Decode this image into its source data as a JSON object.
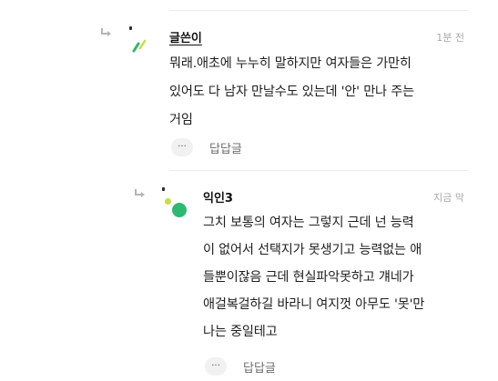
{
  "colors": {
    "text": "#222222",
    "muted": "#a8a8a8",
    "divider": "#ececec",
    "avatar_green": "#2eb872",
    "avatar_yellow_green": "#c6df3a"
  },
  "comments": [
    {
      "author": "글쓴이",
      "time": "1분 전",
      "body_lines": [
        "뭐래.애초에 누누히 말하지만 여자들은 가만히",
        "있어도 다 남자 만날수도 있는데 '안' 만나 주는",
        "거임"
      ],
      "more_label": "···",
      "reply_label": "답답글",
      "reply_icon": "reply-arrow-icon"
    },
    {
      "author": "익인3",
      "time": "지금 막",
      "body_lines": [
        "그치 보통의 여자는 그렇지 근데 넌 능력",
        "이 없어서 선택지가 못생기고 능력없는 애",
        "들뿐이잖음 근데 현실파악못하고 걔네가",
        "애걸복걸하길 바라니 여지껏 아무도 '못'만",
        "나는 중일테고"
      ],
      "more_label": "···",
      "reply_label": "답답글",
      "reply_icon": "reply-arrow-icon"
    }
  ]
}
